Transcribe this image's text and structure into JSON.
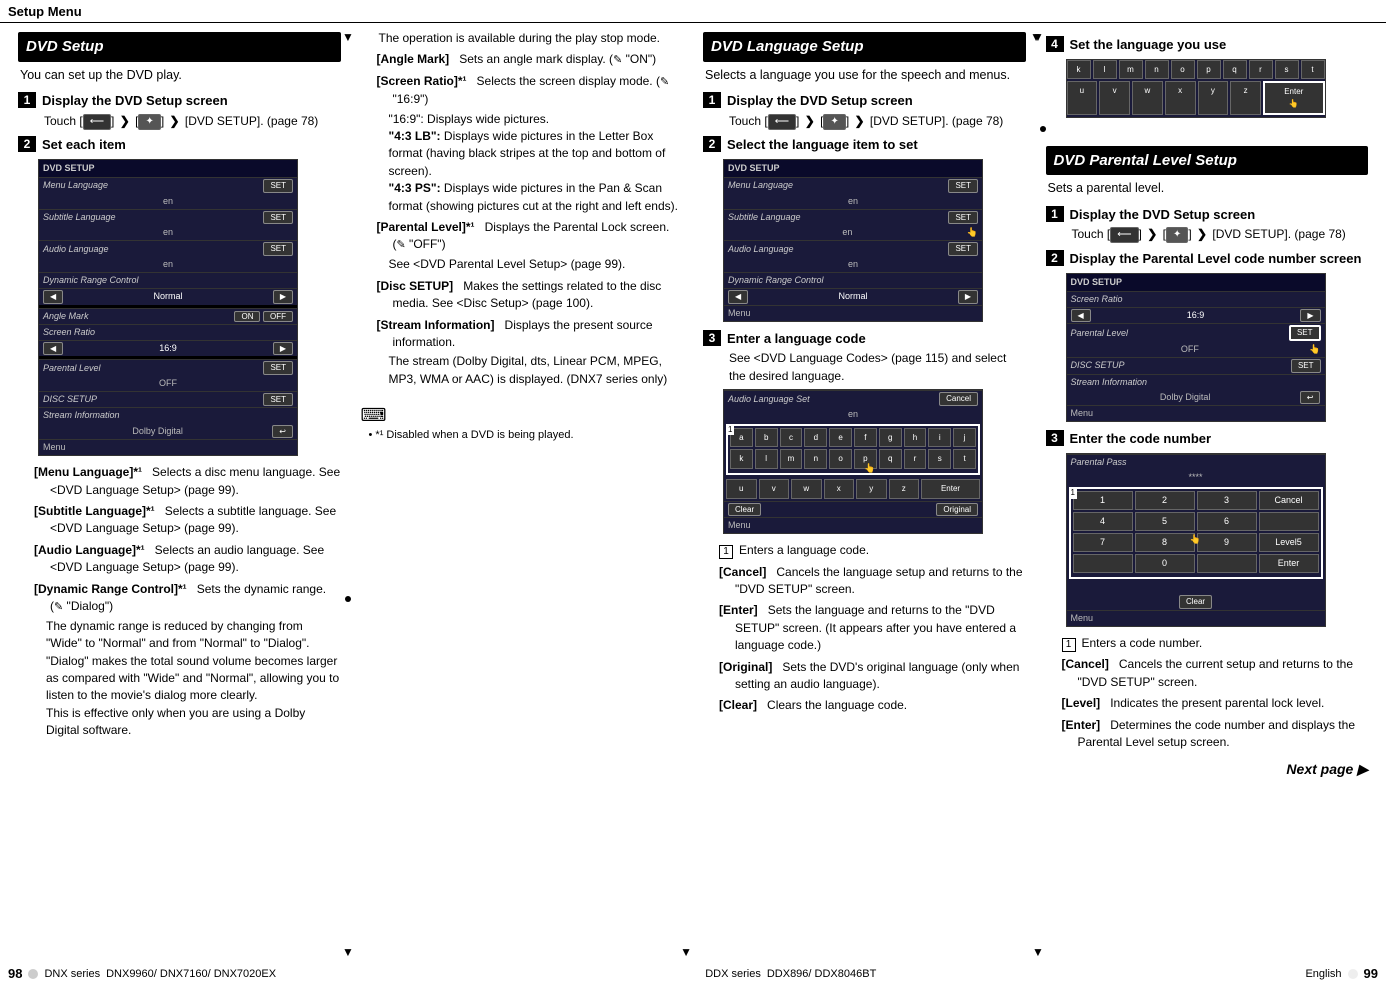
{
  "header": {
    "title": "Setup Menu"
  },
  "col1": {
    "section_title": "DVD Setup",
    "intro": "You can set up the DVD play.",
    "step1_title": "Display the DVD Setup screen",
    "step1_body_prefix": "Touch [",
    "step1_body_mid": "] ",
    "step1_body_suffix": " [DVD SETUP]. (page 78)",
    "step2_title": "Set each item",
    "defs": {
      "menu_lang": "[Menu Language]*¹",
      "menu_lang_body": "Selects a disc menu language. See <DVD Language Setup> (page 99).",
      "subtitle_lang": "[Subtitle Language]*¹",
      "subtitle_lang_body": "Selects a subtitle language. See <DVD Language Setup> (page 99).",
      "audio_lang": "[Audio Language]*¹",
      "audio_lang_body": "Selects an audio language. See <DVD Language Setup> (page 99).",
      "drc": "[Dynamic Range Control]*¹",
      "drc_body1": "Sets the dynamic range. (",
      "drc_body1b": " \"Dialog\")",
      "drc_body2": "The dynamic range is reduced by changing from \"Wide\" to \"Normal\" and from \"Normal\" to \"Dialog\". \"Dialog\" makes the total sound volume becomes larger as compared with \"Wide\" and \"Normal\", allowing you to listen to the movie's dialog more clearly.",
      "drc_body3": "This is effective only when you are using a Dolby Digital software."
    },
    "ss1": {
      "title": "DVD SETUP",
      "r1": "Menu Language",
      "r1v": "en",
      "btn": "SET",
      "r2": "Subtitle Language",
      "r2v": "en",
      "r3": "Audio Language",
      "r3v": "en",
      "r4": "Dynamic Range Control",
      "r4v": "Normal",
      "r5": "Angle Mark",
      "on": "ON",
      "off": "OFF",
      "r6": "Screen Ratio",
      "r6v": "16:9",
      "r7": "Parental Level",
      "r7v": "OFF",
      "r8": "DISC SETUP",
      "r9": "Stream Information",
      "r9v": "Dolby Digital",
      "menu": "Menu"
    }
  },
  "col2": {
    "top_note": "The operation is available during the play stop mode.",
    "angle": "[Angle Mark]",
    "angle_body": "Sets an angle mark display. (",
    "angle_body2": " \"ON\")",
    "screen_ratio": "[Screen Ratio]*¹",
    "screen_ratio_body": "Selects the screen display mode. (",
    "screen_ratio_body2": " \"16:9\")",
    "sr_a": "\"16:9\": Displays wide pictures.",
    "sr_b": "\"4:3 LB\":",
    "sr_b2": " Displays wide pictures in the Letter Box format (having black stripes at the top and bottom of screen).",
    "sr_c": "\"4:3 PS\":",
    "sr_c2": " Displays wide pictures in the Pan & Scan format (showing pictures cut at the right and left ends).",
    "parental": "[Parental Level]*¹",
    "parental_body": "Displays the Parental Lock screen. (",
    "parental_body2": " \"OFF\")",
    "parental_body3": "See <DVD Parental Level Setup> (page 99).",
    "disc": "[Disc SETUP]",
    "disc_body": "Makes the settings related to the disc media. See <Disc Setup> (page 100).",
    "stream": "[Stream Information]",
    "stream_body": "Displays the present source information.",
    "stream_body2": "The stream (Dolby Digital, dts, Linear PCM, MPEG, MP3, WMA or AAC) is displayed. (DNX7 series only)",
    "footnote": "*¹ Disabled when a DVD is being played."
  },
  "col3": {
    "section_title": "DVD Language Setup",
    "intro": "Selects a language you use for the speech and menus.",
    "step1_title": "Display the DVD Setup screen",
    "step1_body": "Touch [",
    "step1_suffix": " [DVD SETUP]. (page 78)",
    "step2_title": "Select the language item to set",
    "step3_title": "Enter a language code",
    "step3_body": "See <DVD Language Codes> (page 115) and select the desired language.",
    "box1_text": "Enters a language code.",
    "cancel": "[Cancel]",
    "cancel_body": "Cancels the language setup and returns to the \"DVD SETUP\" screen.",
    "enter": "[Enter]",
    "enter_body": "Sets the language and returns to the \"DVD SETUP\" screen. (It appears after you have entered a language code.)",
    "original": "[Original]",
    "original_body": "Sets the DVD's original language (only when setting an audio language).",
    "clear": "[Clear]",
    "clear_body": "Clears the language code.",
    "ss2": {
      "title": "DVD SETUP",
      "r1": "Menu Language",
      "r1v": "en",
      "btn": "SET",
      "r2": "Subtitle Language",
      "r2v": "en",
      "r3": "Audio Language",
      "r3v": "en",
      "r4": "Dynamic Range Control",
      "r4v": "Normal",
      "menu": "Menu"
    },
    "ss3": {
      "title": "Audio Language Set",
      "val": "en",
      "cancel": "Cancel",
      "enter": "Enter",
      "clear": "Clear",
      "original": "Original"
    }
  },
  "col4": {
    "step4_title": "Set the language you use",
    "section_title": "DVD Parental Level Setup",
    "intro": "Sets a parental level.",
    "step1_title": "Display the DVD Setup screen",
    "step1_body": "Touch [",
    "step1_suffix": " [DVD SETUP]. (page 78)",
    "step2_title": "Display the Parental Level code number screen",
    "step3_title": "Enter the code number",
    "box1_text": "Enters a code number.",
    "cancel": "[Cancel]",
    "cancel_body": "Cancels the current setup and returns to the \"DVD SETUP\" screen.",
    "level": "[Level]",
    "level_body": "Indicates the present parental lock level.",
    "enter": "[Enter]",
    "enter_body": "Determines the code number and displays the Parental Level setup screen.",
    "next_page": "Next page ▶",
    "ss4": {
      "title": "DVD SETUP",
      "r1": "Screen Ratio",
      "r1v": "16:9",
      "r2": "Parental Level",
      "r2v": "OFF",
      "btn": "SET",
      "r3": "DISC SETUP",
      "r4": "Stream Information",
      "r4v": "Dolby Digital",
      "menu": "Menu"
    },
    "ss5": {
      "title": "Parental Pass",
      "dots": "****",
      "cancel": "Cancel",
      "level5": "Level5",
      "enter": "Enter",
      "clear": "Clear",
      "menu": "Menu"
    }
  },
  "footer": {
    "left_page": "98",
    "left_series": "DNX series",
    "left_models": "DNX9960/ DNX7160/ DNX7020EX",
    "mid_series": "DDX series",
    "mid_models": "DDX896/ DDX8046BT",
    "right_lang": "English",
    "right_page": "99"
  }
}
